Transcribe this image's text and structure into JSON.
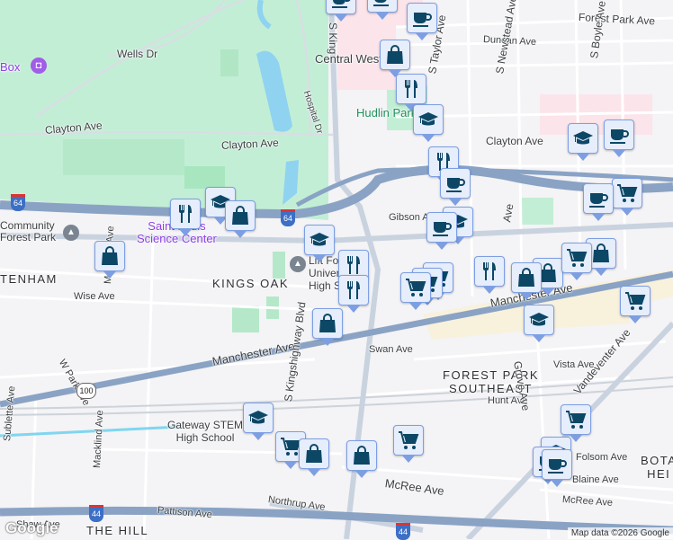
{
  "map": {
    "labels": {
      "wells_dr": "Wells Dr",
      "clayton_ave_1": "Clayton Ave",
      "clayton_ave_2": "Clayton Ave",
      "clayton_ave_3": "Clayton Ave",
      "hospital_dr": "Hospital Dr",
      "box": "Box",
      "central_west": "Central West",
      "hudlin_park": "Hudlin Park",
      "forest_park_ave": "Forest Park Ave",
      "duncan_ave": "Duncan Ave",
      "s_taylor_ave": "S Taylor Ave",
      "s_newstead_ave": "S Newstead Ave",
      "s_boyle_ave": "S Boyle Ave",
      "gibson_ave": "Gibson Ave",
      "s_kingshighway_top": "S King",
      "community_forest_park": "Community\nForest Park",
      "science_center": "Saint Louis\nScience Center",
      "kings_oak": "KINGS OAK",
      "tenham": "TENHAM",
      "wise_ave": "Wise Ave",
      "macklind_ave_1": "Macklind Ave",
      "macklind_ave_2": "Macklind Ave",
      "university_high": "Lift For Life\nUniversity\nHigh School",
      "manchester_ave_1": "Manchester Ave",
      "manchester_ave_2": "Manchester Ave",
      "w_park_ave": "W Park Ave",
      "swan_ave": "Swan Ave",
      "s_kingshighway_blvd": "S Kingshighway Blvd",
      "forest_park_southeast": "FOREST PARK\nSOUTHEAST",
      "vista_ave": "Vista Ave",
      "hunt_ave": "Hunt Ave",
      "grove_ave": "Grove Ave",
      "vandeventer_ave": "Vandeventer Ave",
      "sublette_ave": "Sublette Ave",
      "gateway_stem": "Gateway STEM\nHigh School",
      "mcree_ave_1": "McRee Ave",
      "mcree_ave_2": "McRee Ave",
      "folsom_ave": "Folsom Ave",
      "lafayette_ave": "Blaine Ave",
      "botanical_heights": "BOTA\nHEI",
      "northrup_ave": "Northrup Ave",
      "pattison_ave": "Pattison Ave",
      "shaw_ave": "Shaw Ave",
      "the_hill": "THE HILL",
      "rd_ave": "Ave"
    },
    "shields": {
      "i64_a": "64",
      "i64_b": "64",
      "i44_a": "44",
      "i44_b": "44",
      "us100": "100"
    },
    "attribution": "Map data ©2026 Google",
    "logo": "Google",
    "colors": {
      "park": "#c3eed6",
      "water": "#8fd3f0",
      "highway": "#8aa3c4",
      "marker_icon": "#0c4766",
      "marker_bg": "#e6edfb",
      "marker_border": "#7d9fe2"
    }
  }
}
